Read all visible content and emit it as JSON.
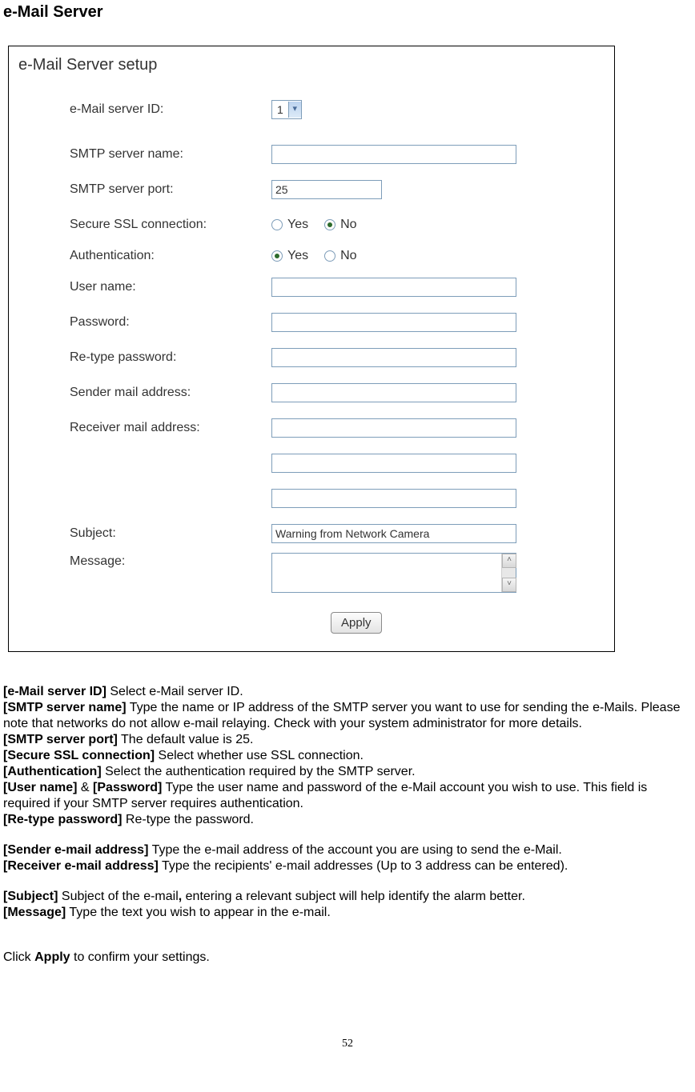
{
  "heading": "e-Mail Server",
  "form": {
    "title": "e-Mail Server setup",
    "emailServerId": {
      "label": "e-Mail server ID:",
      "value": "1"
    },
    "smtpName": {
      "label": "SMTP server name:",
      "value": ""
    },
    "smtpPort": {
      "label": "SMTP server port:",
      "value": "25"
    },
    "ssl": {
      "label": "Secure SSL connection:",
      "yes": "Yes",
      "no": "No",
      "selected": "no"
    },
    "auth": {
      "label": "Authentication:",
      "yes": "Yes",
      "no": "No",
      "selected": "yes"
    },
    "userName": {
      "label": "User name:",
      "value": ""
    },
    "password": {
      "label": "Password:",
      "value": ""
    },
    "retype": {
      "label": "Re-type password:",
      "value": ""
    },
    "sender": {
      "label": "Sender mail address:",
      "value": ""
    },
    "receiver": {
      "label": "Receiver mail address:",
      "values": [
        "",
        "",
        ""
      ]
    },
    "subject": {
      "label": "Subject:",
      "value": "Warning from Network Camera"
    },
    "message": {
      "label": "Message:",
      "value": ""
    },
    "applyLabel": "Apply"
  },
  "desc": {
    "l1a": "[e-Mail server ID]",
    "l1b": " Select e-Mail server ID.",
    "l2a": "[SMTP server name]",
    "l2b": " Type the name or IP address of the SMTP server you want to use for sending the e-Mails. Please note that networks do not allow e-mail relaying. Check with your system administrator for more details.",
    "l3a": "[SMTP server port]",
    "l3b": " The default value is 25.",
    "l4a": "[Secure SSL connection]",
    "l4b": " Select whether use SSL connection.",
    "l5a": "[Authentication]",
    "l5b": " Select the authentication required by the SMTP server.",
    "l6a": "[User name]",
    "l6amp": " & ",
    "l6b": "[Password]",
    "l6c": " Type the user name and password of the e-Mail account you wish to use. This field is required if your SMTP server requires authentication.",
    "l7a": "[Re-type password]",
    "l7b": " Re-type the password.",
    "l8a": "[Sender e-mail address]",
    "l8b": " Type the e-mail address of the account you are using to send the e-Mail.",
    "l9a": "[Receiver e-mail address]",
    "l9b": " Type the recipients' e-mail addresses (Up to 3 address can be entered).",
    "l10a": "[Subject]",
    "l10b": " Subject of the e-mail",
    "l10comma": ",",
    "l10c": " entering a relevant subject will help identify the alarm better.",
    "l11a": "[Message]",
    "l11b": " Type the text you wish to appear in the e-mail.",
    "l12a": "Click ",
    "l12b": "Apply",
    "l12c": " to confirm your settings."
  },
  "pageNumber": "52"
}
